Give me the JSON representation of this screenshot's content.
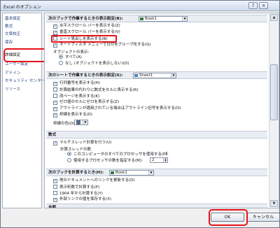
{
  "window": {
    "title": "Excel のオプション",
    "help_glyph": "?",
    "close_glyph": "×"
  },
  "sidebar": {
    "items": [
      "基本設定",
      "数式",
      "文章校正",
      "保存",
      "詳細設定",
      "ユーザー設定",
      "アドイン",
      "セキュリティ センター",
      "リソース"
    ]
  },
  "sections": {
    "book": {
      "title": "次のブックで作業するときの表示設定(B):",
      "dropdown": "Book1"
    },
    "sheet": {
      "title": "次のシートで作業するときの表示設定(S):",
      "dropdown": "Sheet1"
    },
    "formula": {
      "title": "数式"
    },
    "calc": {
      "title": "次のブックを計算するとき(H):",
      "dropdown": "Book1"
    },
    "general": {
      "title": "全般"
    }
  },
  "book_options": [
    {
      "label": "水平スクロール バーを表示する(Z)",
      "checked": true
    },
    {
      "label": "垂直スクロール バーを表示する(V)",
      "checked": true
    },
    {
      "label": "シート見出しを表示する(B)",
      "checked": false
    },
    {
      "label": "オートフィルタ メニューで日付をグループ化する(G)",
      "checked": true
    }
  ],
  "objects": {
    "label": "オブジェクトの表示:",
    "options": [
      {
        "label": "すべて(A)",
        "selected": true
      },
      {
        "label": "なし (オブジェクトを表示しない)(D)",
        "selected": false
      }
    ]
  },
  "sheet_options": [
    {
      "label": "行列番号を表示する(H)",
      "checked": true
    },
    {
      "label": "計算結果の代わりに数式をセルに表示する(R)",
      "checked": false
    },
    {
      "label": "改ページを表示する(K)",
      "checked": false
    },
    {
      "label": "ゼロ値のセルにゼロを表示する(Z)",
      "checked": true
    },
    {
      "label": "アウトラインが適用されている場合はアウトライン記号を表示する(O)",
      "checked": true
    },
    {
      "label": "枠線を表示する(D)",
      "checked": true
    }
  ],
  "gridline_color": {
    "label": "枠線の色(D)"
  },
  "formula_options": {
    "multithread": {
      "label": "マルチスレッド計算を行う(U)",
      "checked": true
    },
    "threads_label": "計算スレッドの数",
    "thread_options": [
      {
        "label": "このコンピュータのすべてのプロセッサを使用する(P):",
        "value": "2",
        "selected": true
      },
      {
        "label": "使用するプロセッサの数を指定する(M):",
        "value": "2",
        "selected": false
      }
    ]
  },
  "calc_options": [
    {
      "label": "他のドキュメントへのリンクを更新する(D)",
      "checked": true
    },
    {
      "label": "表示桁数で計算する(P)",
      "checked": false
    },
    {
      "label": "1904 年から計算する(Y)",
      "checked": false
    },
    {
      "label": "外部リンクの値を保存する(X)",
      "checked": true
    }
  ],
  "buttons": {
    "ok": "OK",
    "cancel": "キャンセル"
  },
  "colors": {
    "highlight": "#e8121b",
    "link": "#1f3e78"
  }
}
